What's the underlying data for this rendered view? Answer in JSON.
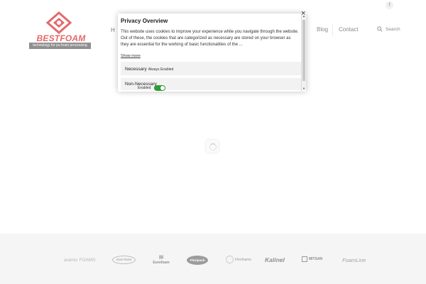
{
  "header": {
    "logo_text": "BESTFOAM",
    "logo_tagline": "technology for pu foam processing",
    "nav_peek": "H",
    "nav": [
      {
        "label": "Blog"
      },
      {
        "label": "Contact"
      }
    ],
    "search_label": "Search",
    "social_icon_glyph": "f"
  },
  "cookie_modal": {
    "title": "Privacy Overview",
    "body": "This website uses cookies to improve your experience while you navigate through the website. Out of these, the cookies that are categorized as necessary are stored on your browser as they are essential for the working of basic functionalities of the ...",
    "show_more": "Show more",
    "close_glyph": "×",
    "categories": [
      {
        "name": "Necessary",
        "status": "Always Enabled"
      },
      {
        "name": "Non-Necessary",
        "status": "Enabled",
        "toggle_on": true
      }
    ],
    "toggle_color": "#2e9c3a"
  },
  "partners": [
    {
      "name": "aramis",
      "suffix": "FOAMS"
    },
    {
      "name": "Oasi Rossi"
    },
    {
      "name": "Eurofoam"
    },
    {
      "name": "Flexipack"
    },
    {
      "name": "Flexfoams"
    },
    {
      "name": "Kalinel"
    },
    {
      "name": "MITSAN"
    },
    {
      "name": "FoamLine"
    }
  ],
  "colors": {
    "brand": "#e36a6a",
    "footer_bg": "#f5f5f5"
  }
}
